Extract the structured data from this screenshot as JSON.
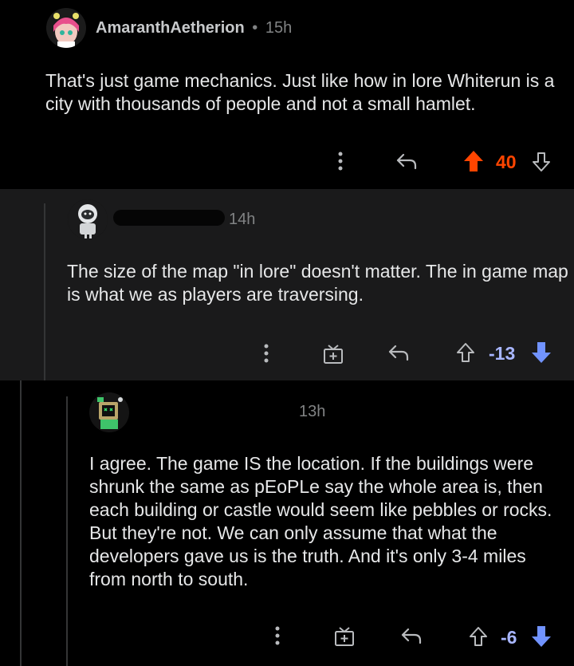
{
  "colors": {
    "upvote_active": "#ff4500",
    "downvote_active": "#7193ff",
    "icon": "#b9bbbe"
  },
  "comments": [
    {
      "author": "AmaranthAetherion",
      "separator": "•",
      "time": "15h",
      "text": "That's just game mechanics. Just like how in lore Whiterun is a city with thousands of people and not a small hamlet.",
      "score": "40",
      "vote_state": "upvoted"
    },
    {
      "author": "",
      "author_redacted": true,
      "time": "14h",
      "text": "The size of the map \"in lore\" doesn't matter. The in game map is what we as players are traversing.",
      "score": "-13",
      "vote_state": "downvoted"
    },
    {
      "author": "",
      "time": "13h",
      "text": "I agree. The game IS the location. If the buildings were shrunk the same as pEoPLe say the whole area is, then each building or castle would seem like pebbles or rocks. But they're not. We can only assume that what the developers gave us is the truth. And it's only 3-4 miles from north to south.",
      "score": "-6",
      "vote_state": "downvoted"
    }
  ]
}
